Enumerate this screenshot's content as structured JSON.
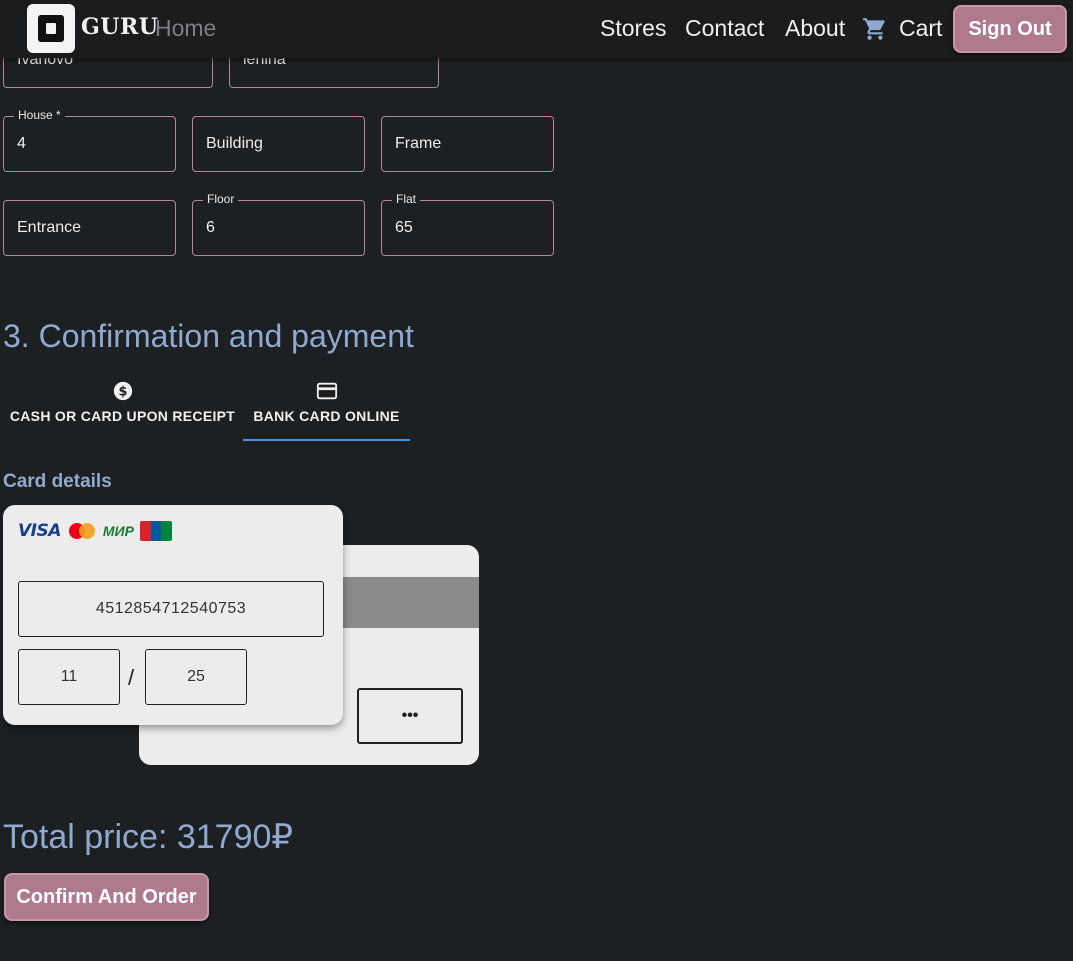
{
  "nav": {
    "brand": "GURU",
    "home": "Home",
    "links": [
      "Stores",
      "Contact",
      "About",
      "Cart"
    ],
    "sign_out": "Sign Out"
  },
  "address": {
    "city": "Ivanovo",
    "street": "lenina",
    "house_label": "House *",
    "house": "4",
    "building_placeholder": "Building",
    "frame_placeholder": "Frame",
    "entrance_placeholder": "Entrance",
    "floor_label": "Floor",
    "floor": "6",
    "flat_label": "Flat",
    "flat": "65"
  },
  "payment": {
    "title": "3. Confirmation and payment",
    "tabs": [
      {
        "label": "CASH OR CARD UPON RECEIPT",
        "icon": "dollar-circle-icon"
      },
      {
        "label": "BANK CARD ONLINE",
        "icon": "credit-card-icon",
        "selected": true
      }
    ],
    "card_details_label": "Card details",
    "card": {
      "brands": [
        "VISA",
        "Mastercard",
        "MIR",
        "UnionPay"
      ],
      "visa_text": "VISA",
      "mir_text": "МИР",
      "number": "4512854712540753",
      "exp_month": "11",
      "exp_separator": "/",
      "exp_year": "25",
      "cvc": "•••"
    }
  },
  "total": "Total price: 31790₽",
  "confirm_label": "Confirm And Order",
  "colors": {
    "background": "#1d2023",
    "accent_button": "#b07a8e",
    "heading_blue": "#8fa9cf",
    "field_border": "#b88599",
    "tab_indicator": "#4a90e2"
  }
}
